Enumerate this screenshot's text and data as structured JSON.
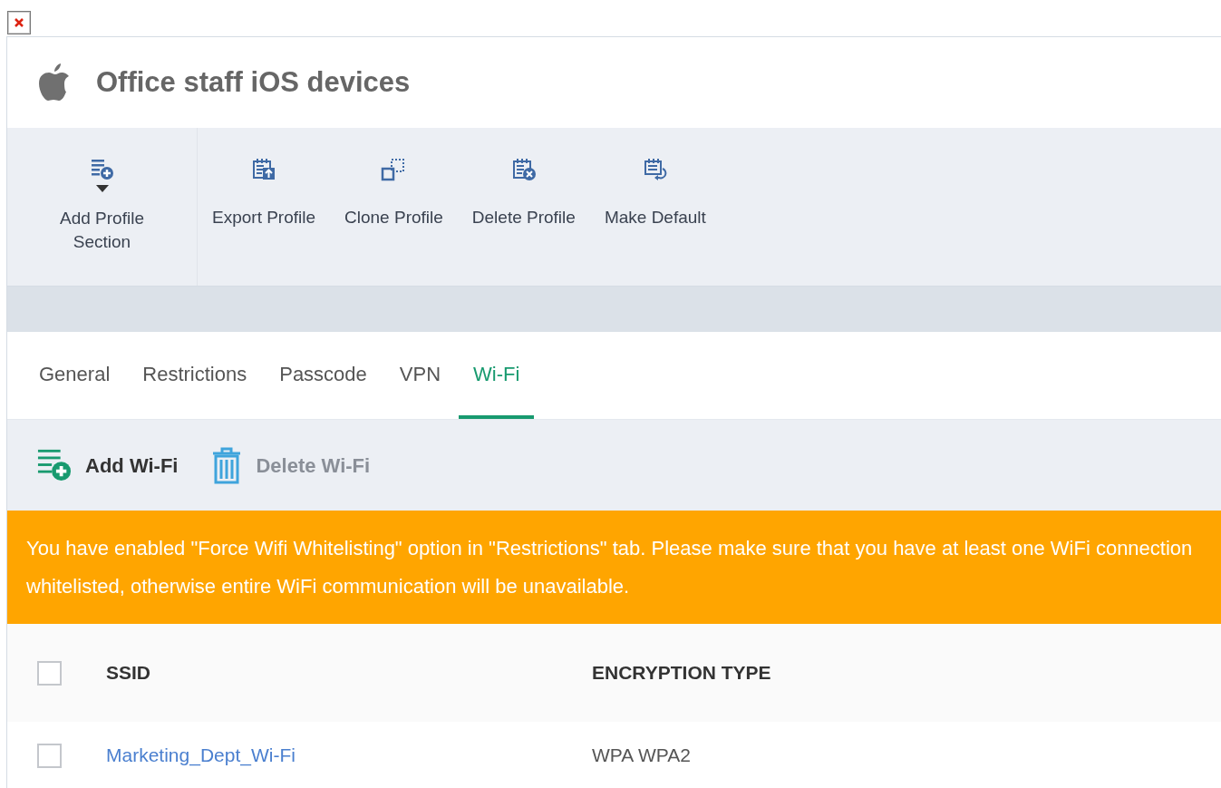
{
  "profile": {
    "title": "Office staff iOS devices"
  },
  "toolbar": [
    {
      "kind": "add",
      "label": "Add Profile Section",
      "dropdown": true
    },
    {
      "kind": "export",
      "label": "Export Profile",
      "dropdown": false
    },
    {
      "kind": "clone",
      "label": "Clone Profile",
      "dropdown": false
    },
    {
      "kind": "delete",
      "label": "Delete Profile",
      "dropdown": false
    },
    {
      "kind": "default",
      "label": "Make Default",
      "dropdown": false
    }
  ],
  "tabs": [
    {
      "label": "General",
      "selected": false
    },
    {
      "label": "Restrictions",
      "selected": false
    },
    {
      "label": "Passcode",
      "selected": false
    },
    {
      "label": "VPN",
      "selected": false
    },
    {
      "label": "Wi-Fi",
      "selected": true
    }
  ],
  "actions": [
    {
      "kind": "add",
      "label": "Add Wi-Fi",
      "disabled": false
    },
    {
      "kind": "delete",
      "label": "Delete Wi-Fi",
      "disabled": true
    }
  ],
  "warning": "You have enabled \"Force Wifi Whitelisting\" option in \"Restrictions\" tab. Please make sure that you have at least one WiFi connection whitelisted, otherwise entire WiFi communication will be unavailable.",
  "table": {
    "select_all_checked": false,
    "columns": [
      "SSID",
      "ENCRYPTION TYPE"
    ],
    "rows": [
      {
        "checked": false,
        "ssid": "Marketing_Dept_Wi-Fi",
        "encryption": "WPA WPA2"
      }
    ]
  }
}
